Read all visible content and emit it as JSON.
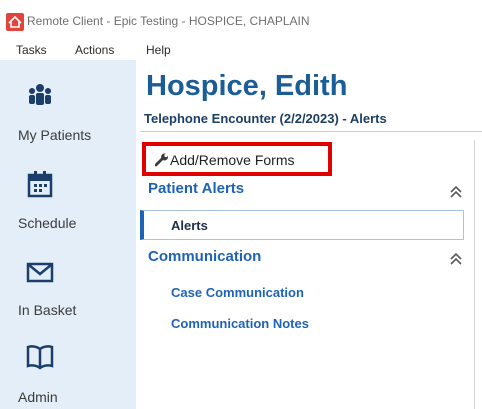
{
  "window": {
    "title": "Remote Client - Epic Testing - HOSPICE, CHAPLAIN",
    "brand_color": "#e1443b"
  },
  "menu": [
    {
      "label": "Tasks"
    },
    {
      "label": "Actions"
    },
    {
      "label": "Help"
    }
  ],
  "sidebar": {
    "items": [
      {
        "label": "My Patients",
        "icon": "patients-icon"
      },
      {
        "label": "Schedule",
        "icon": "calendar-icon"
      },
      {
        "label": "In Basket",
        "icon": "envelope-icon"
      },
      {
        "label": "Admin",
        "icon": "book-icon"
      }
    ]
  },
  "patient": {
    "name": "Hospice, Edith"
  },
  "encounter": {
    "title": "Telephone Encounter  (2/2/2023) - Alerts"
  },
  "toolbar": {
    "add_remove_forms": "Add/Remove Forms"
  },
  "sections": [
    {
      "title": "Patient Alerts",
      "items": [
        {
          "label": "Alerts",
          "selected": true
        }
      ]
    },
    {
      "title": "Communication",
      "items": [
        {
          "label": "Case Communication"
        },
        {
          "label": "Communication Notes"
        }
      ]
    }
  ],
  "colors": {
    "sidebar_bg": "#e3eef8",
    "accent": "#1f63b6",
    "highlight_box": "#e10000"
  }
}
